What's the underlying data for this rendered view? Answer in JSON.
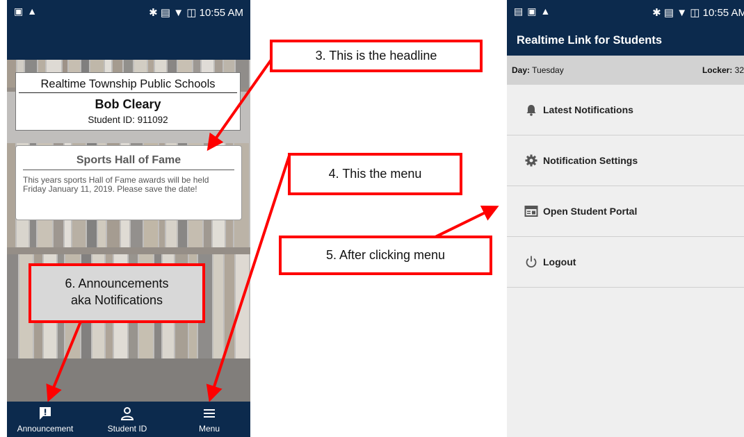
{
  "left_phone": {
    "status_bar": {
      "time": "10:55 AM"
    },
    "school_name": "Realtime Township Public Schools",
    "student_name": "Bob Cleary",
    "student_id": "Student ID: 911092",
    "headline": {
      "title": "Sports Hall of Fame",
      "body": "This years sports Hall of Fame awards will be held Friday January 11, 2019. Please save the date!"
    },
    "bottom_nav": [
      {
        "label": "Announcement",
        "icon": "announcement-icon"
      },
      {
        "label": "Student ID",
        "icon": "person-icon"
      },
      {
        "label": "Menu",
        "icon": "hamburger-menu-icon"
      }
    ]
  },
  "right_phone": {
    "status_bar": {
      "time": "10:55 AM"
    },
    "app_title": "Realtime Link for Students",
    "info": {
      "day_label": "Day:",
      "day_value": "Tuesday",
      "locker_label": "Locker:",
      "locker_value": "32"
    },
    "menu": [
      {
        "label": "Latest Notifications",
        "icon": "bell-icon"
      },
      {
        "label": "Notification Settings",
        "icon": "gear-icon"
      },
      {
        "label": "Open Student Portal",
        "icon": "portal-window-icon"
      },
      {
        "label": "Logout",
        "icon": "power-icon"
      }
    ]
  },
  "annotations": {
    "headline": "3. This is the headline",
    "menu": "4. This the menu",
    "after_click": "5. After clicking menu",
    "announcements_line1": "6. Announcements",
    "announcements_line2": "aka Notifications"
  },
  "colors": {
    "navy": "#0c2a4d",
    "annotation_red": "#ff0000",
    "menu_background": "#efefef",
    "info_bar": "#d2d2d2"
  }
}
